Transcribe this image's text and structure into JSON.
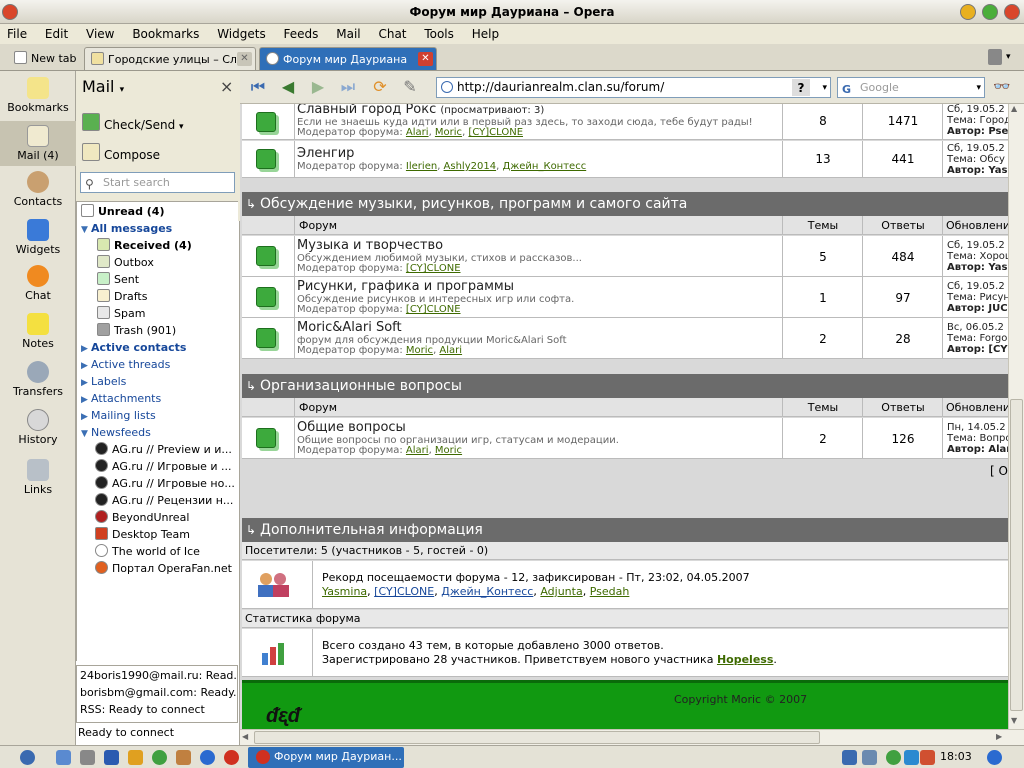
{
  "window": {
    "title": "Форум мир Дауриана – Opera"
  },
  "menu": [
    "File",
    "Edit",
    "View",
    "Bookmarks",
    "Widgets",
    "Feeds",
    "Mail",
    "Chat",
    "Tools",
    "Help"
  ],
  "tabs": {
    "new_tab": "New tab",
    "tab1": "Городские улицы – Сл...",
    "tab2": "Форум мир Дауриана"
  },
  "sidepanel": {
    "items": [
      "Bookmarks",
      "Mail (4)",
      "Contacts",
      "Widgets",
      "Chat",
      "Notes",
      "Transfers",
      "History",
      "Links"
    ]
  },
  "mail": {
    "title": "Mail",
    "check_send": "Check/Send",
    "compose": "Compose",
    "search_placeholder": "Start search",
    "close": "×",
    "tree": [
      {
        "label": "Unread (4)"
      },
      {
        "label": "All messages"
      },
      {
        "label": "Received (4)"
      },
      {
        "label": "Outbox"
      },
      {
        "label": "Sent"
      },
      {
        "label": "Drafts"
      },
      {
        "label": "Spam"
      },
      {
        "label": "Trash (901)"
      },
      {
        "label": "Active contacts"
      },
      {
        "label": "Active threads"
      },
      {
        "label": "Labels"
      },
      {
        "label": "Attachments"
      },
      {
        "label": "Mailing lists"
      },
      {
        "label": "Newsfeeds"
      },
      {
        "label": "AG.ru // Preview и и..."
      },
      {
        "label": "AG.ru // Игровые и ..."
      },
      {
        "label": "AG.ru // Игровые но..."
      },
      {
        "label": "AG.ru // Рецензии н..."
      },
      {
        "label": "BeyondUnreal"
      },
      {
        "label": "Desktop Team"
      },
      {
        "label": "The world of Ice"
      },
      {
        "label": "Портал OperaFan.net"
      }
    ],
    "accounts": [
      "24boris1990@mail.ru: Read...",
      "borisbm@gmail.com: Ready...",
      "RSS: Ready to connect"
    ],
    "status": "Ready to connect"
  },
  "toolbar": {
    "url": "http://daurianrealm.clan.su/forum/",
    "search_placeholder": "Google"
  },
  "forum": {
    "row_top": {
      "title": "Славный город Рокс",
      "viewing": "(просматривают: 3)",
      "desc": "Если не знаешь куда идти или в первый раз здесь, то заходи сюда, тебе будут рады!",
      "mod_label": "Модератор форума:",
      "mods": [
        "Alari",
        "Moric",
        "[CY]CLONE"
      ],
      "topics": "8",
      "replies": "1471",
      "upd": [
        "Сб, 19.05.2",
        "Тема: Город",
        "Автор: Psed"
      ]
    },
    "row_el": {
      "title": "Эленгир",
      "mod_label": "Модератор форума:",
      "mods": [
        "Ilerien",
        "Ashly2014",
        "Джейн_Контесс"
      ],
      "topics": "13",
      "replies": "441",
      "upd": [
        "Сб, 19.05.2",
        "Тема: Обсу",
        "Автор: Yasm"
      ]
    },
    "section2": {
      "title": "Обсуждение музыки, рисунков, программ и самого сайта",
      "cols": [
        "Форум",
        "Темы",
        "Ответы",
        "Обновлени"
      ]
    },
    "music": {
      "title": "Музыка и творчество",
      "desc": "Обсуждением любимой музыки, стихов и рассказов...",
      "mod_label": "Модератор форума:",
      "mods": [
        "[CY]CLONE"
      ],
      "topics": "5",
      "replies": "484",
      "upd": [
        "Сб, 19.05.2",
        "Тема: Хорош",
        "Автор: Yasm"
      ]
    },
    "pics": {
      "title": "Рисунки, графика и программы",
      "desc": "Обсуждение рисунков и интересных игр или софта.",
      "mod_label": "Модератор форума:",
      "mods": [
        "[CY]CLONE"
      ],
      "topics": "1",
      "replies": "97",
      "upd": [
        "Сб, 19.05.2",
        "Тема: Рисун",
        "Автор: JUCo"
      ]
    },
    "soft": {
      "title": "Moric&Alari Soft",
      "desc": "форум для обсуждения продукции Moric&Alari Soft",
      "mod_label": "Модератор форума:",
      "mods": [
        "Moric",
        "Alari"
      ],
      "topics": "2",
      "replies": "28",
      "upd": [
        "Вс, 06.05.2",
        "Тема: Forgo",
        "Автор: [CY]"
      ]
    },
    "section3": {
      "title": "Организационные вопросы",
      "cols": [
        "Форум",
        "Темы",
        "Ответы",
        "Обновлени"
      ]
    },
    "general": {
      "title": "Общие вопросы",
      "desc": "Общие вопросы по организации игр, статусам и модерации.",
      "mod_label": "Модератор форума:",
      "mods": [
        "Alari",
        "Moric"
      ],
      "topics": "2",
      "replies": "126",
      "upd": [
        "Пн, 14.05.2",
        "Тема: Вопро",
        "Автор: Alari"
      ]
    },
    "bracket_link": "[ О",
    "extra": {
      "title": "Дополнительная информация",
      "visitors": "Посетители: 5  (участников - 5, гостей - 0)",
      "record": "Рекорд посещаемости форума - 12, зафиксирован - Пт, 23:02, 04.05.2007",
      "record_users": [
        "Yasmina",
        "[CY]CLONE",
        "Джейн_Контесс",
        "Adjunta",
        "Psedah"
      ],
      "stats_label": "Статистика форума",
      "stats1": "Всего создано 43 тем, в которые добавлено 3000 ответов.",
      "stats2_prefix": "Зарегистрировано 28 участников. Приветствуем нового участника",
      "stats2_user": "Hopeless",
      "stats2_suffix": "."
    },
    "copyright": "Copyright Moric © 2007"
  },
  "taskbar": {
    "task": "Форум мир Дауриан...",
    "clock": "18:03"
  },
  "colors": {
    "accent": "#2f6fb8",
    "forum_green": "#3daa3d",
    "section_head": "#6b6b6b",
    "footer": "#119911",
    "link": "#3e6a00"
  }
}
